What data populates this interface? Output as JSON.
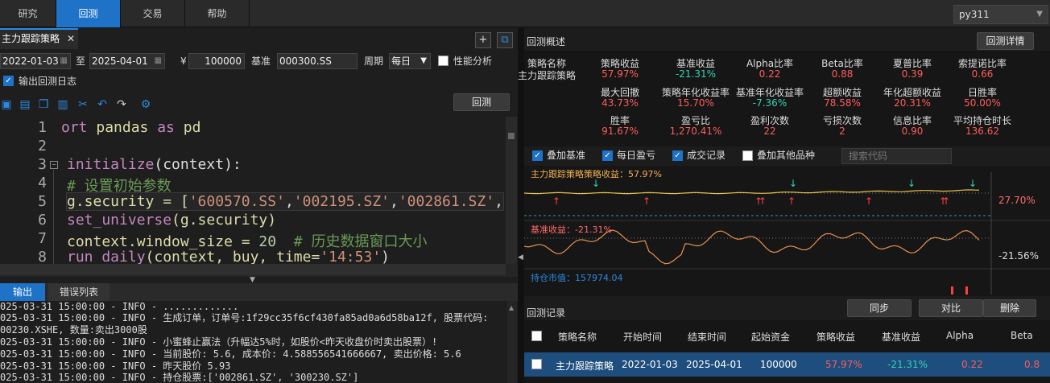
{
  "nav": {
    "tabs": [
      "研究",
      "回测",
      "交易",
      "帮助"
    ],
    "active": "回测",
    "env": "py311"
  },
  "editor_tab": {
    "title": "主力跟踪策略",
    "close": "✕"
  },
  "params": {
    "start_date": "2022-01-03",
    "to": "至",
    "end_date": "2025-04-01",
    "currency": "¥",
    "capital": "100000",
    "benchmark_label": "基准",
    "benchmark": "000300.SS",
    "frequency_label": "周期",
    "frequency": "每日",
    "perf_label": "性能分析",
    "log_label": "输出回测日志",
    "run_button": "回测"
  },
  "code": {
    "line_numbers": [
      "1",
      "2",
      "3",
      "4",
      "5",
      "6",
      "7",
      "8"
    ],
    "lines": {
      "l1a": "ort ",
      "l1b": "pandas ",
      "l1c": "as",
      "l1d": " pd",
      "l3a": "initialize",
      "l3b": "(context):",
      "l4": "# 设置初始参数",
      "l5a": "g.security = [",
      "l5b": "'600570.SS'",
      "l5c": ",",
      "l5d": "'002195.SZ'",
      "l5e": ",",
      "l5f": "'002861.SZ'",
      "l5g": ",",
      "l6a": "set_universe",
      "l6b": "(g.security)",
      "l7a": "context.window_size = ",
      "l7b": "20",
      "l7c": "  # 历史数据窗口大小",
      "l8a": "run_daily",
      "l8b": "(context, buy, time=",
      "l8c": "'14:53'",
      "l8d": ")"
    }
  },
  "output": {
    "tabs": [
      "输出",
      "错误列表"
    ],
    "lines": [
      "025-03-31 15:00:00 - INFO - .............",
      "025-03-31 15:00:00 - INFO - 生成订单，订单号:1f29cc35f6cf430fa85ad0a6d58ba12f, 股票代码:",
      "00230.XSHE, 数量:卖出3000股",
      "025-03-31 15:00:00 - INFO - 小蜜蜂止赢法（升幅达5%时，如股价<昨天收盘价时卖出股票）!",
      "025-03-31 15:00:00 - INFO - 当前股价: 5.6, 成本价: 4.588556541666667, 卖出价格: 5.6",
      "025-03-31 15:00:00 - INFO - 昨天股价 5.93",
      "025-03-31 15:00:00 - INFO - 持仓股票:['002861.SZ', '300230.SZ']"
    ]
  },
  "overview": {
    "title": "回测概述",
    "detail_button": "回测详情",
    "name_label": "策略名称",
    "name_value": "主力跟踪策略",
    "metrics": [
      {
        "label": "策略收益",
        "value": "57.97%",
        "color": "red"
      },
      {
        "label": "基准收益",
        "value": "-21.31%",
        "color": "green"
      },
      {
        "label": "Alpha比率",
        "value": "0.22",
        "color": "red"
      },
      {
        "label": "Beta比率",
        "value": "0.88",
        "color": "red"
      },
      {
        "label": "夏普比率",
        "value": "0.39",
        "color": "red"
      },
      {
        "label": "索提诺比率",
        "value": "0.66",
        "color": "red"
      },
      {
        "label": "最大回撤",
        "value": "43.73%",
        "color": "red"
      },
      {
        "label": "策略年化收益率",
        "value": "15.70%",
        "color": "red"
      },
      {
        "label": "基准年化收益率",
        "value": "-7.36%",
        "color": "green"
      },
      {
        "label": "超额收益",
        "value": "78.58%",
        "color": "red"
      },
      {
        "label": "年化超额收益",
        "value": "20.31%",
        "color": "red"
      },
      {
        "label": "日胜率",
        "value": "50.00%",
        "color": "red"
      },
      {
        "label": "胜率",
        "value": "91.67%",
        "color": "red"
      },
      {
        "label": "盈亏比",
        "value": "1,270.41%",
        "color": "red"
      },
      {
        "label": "盈利次数",
        "value": "22",
        "color": "red"
      },
      {
        "label": "亏损次数",
        "value": "2",
        "color": "red"
      },
      {
        "label": "信息比率",
        "value": "0.90",
        "color": "red"
      },
      {
        "label": "平均持仓时长",
        "value": "136.62",
        "color": "red"
      }
    ]
  },
  "chart_options": {
    "items": [
      "叠加基准",
      "每日盈亏",
      "成交记录",
      "叠加其他品种"
    ],
    "search_placeholder": "搜索代码"
  },
  "chart_data": [
    {
      "type": "line",
      "title": "主力跟踪策略策略收益：57.97%",
      "last_value_label": "27.70%",
      "buy_markers": 9,
      "sell_markers": 6
    },
    {
      "type": "line",
      "title": "基准收益：-21.31%",
      "last_value_label": "-21.56%"
    },
    {
      "type": "bar",
      "title": "持仓市值：157974.04"
    }
  ],
  "records": {
    "title": "回测记录",
    "buttons": [
      "同步",
      "对比",
      "删除"
    ],
    "columns": [
      "策略名称",
      "开始时间",
      "结束时间",
      "起始资金",
      "策略收益",
      "基准收益",
      "Alpha",
      "Beta"
    ],
    "rows": [
      [
        "主力跟踪策略",
        "2022-01-03",
        "2025-04-01",
        "100000",
        "57.97%",
        "-21.31%",
        "0.22",
        "0.8"
      ]
    ]
  },
  "colors": {
    "accent": "#1e73c8",
    "up": "#ff5c5c",
    "down": "#34d3b4",
    "line": "#f0a050"
  }
}
